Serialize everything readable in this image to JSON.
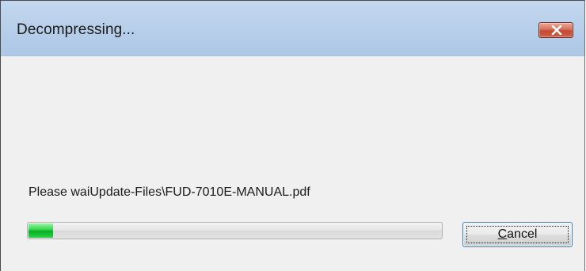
{
  "window": {
    "title": "Decompressing..."
  },
  "message": "Please waiUpdate-Files\\FUD-7010E-MANUAL.pdf",
  "progress": {
    "percent": 6,
    "fill_color": "#06b025"
  },
  "buttons": {
    "cancel_label": "Cancel",
    "close_icon": "close-icon"
  },
  "colors": {
    "titlebar": "#b9d0ea",
    "close_button": "#c24a34",
    "client_background": "#f0f0f0"
  }
}
